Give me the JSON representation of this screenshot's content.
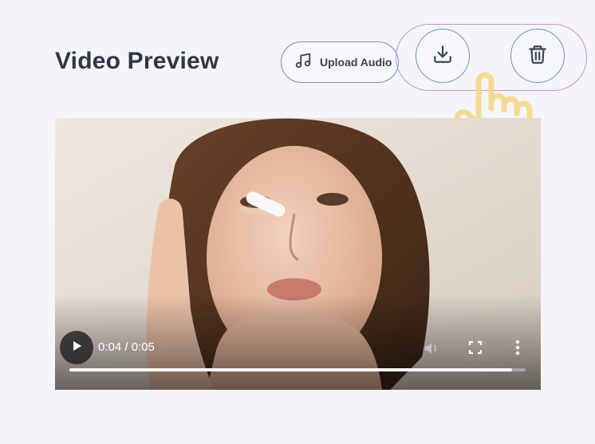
{
  "header": {
    "title": "Video Preview"
  },
  "toolbar": {
    "upload_label": "Upload Audio",
    "upload_icon": "music-note-icon",
    "download_icon": "download-icon",
    "delete_icon": "trash-icon",
    "accent_color": "#6f8fcf",
    "highlight_color": "#d889dd"
  },
  "video": {
    "current_time": "0:04",
    "duration": "0:05",
    "time_display": "0:04 / 0:05",
    "progress_fraction": 0.97
  }
}
